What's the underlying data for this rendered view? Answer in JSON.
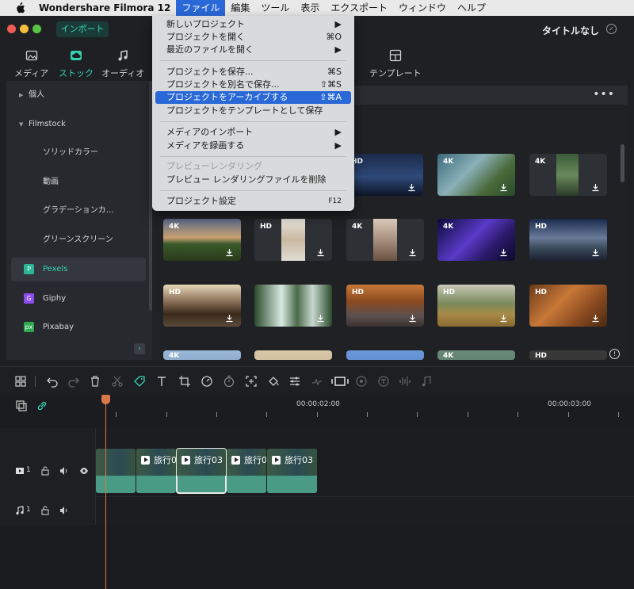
{
  "menubar": {
    "app_name": "Wondershare Filmora 12",
    "items": [
      "ファイル",
      "編集",
      "ツール",
      "表示",
      "エクスポート",
      "ウィンドウ",
      "ヘルプ"
    ]
  },
  "titlebar": {
    "import_label": "インポート",
    "title": "タイトルなし"
  },
  "tabs": [
    {
      "label": "メディア",
      "icon": "image-icon"
    },
    {
      "label": "ストック",
      "icon": "cloud-icon"
    },
    {
      "label": "オーディオ",
      "icon": "music-note-icon"
    },
    {
      "label": "テンプレート",
      "icon": "template-icon"
    }
  ],
  "sidebar": {
    "personal": "個人",
    "filmstock": "Filmstock",
    "filmstock_items": [
      "ソリッドカラー",
      "動画",
      "グラデーションカ…",
      "グリーンスクリーン"
    ],
    "providers": [
      {
        "label": "Pexels",
        "badge": "P",
        "color": "#2bb596"
      },
      {
        "label": "Giphy",
        "badge": "G",
        "color": "#8c4cf0"
      },
      {
        "label": "Pixabay",
        "badge": "px",
        "color": "#2ea84f"
      }
    ]
  },
  "thumbnails": [
    {
      "label": "HD"
    },
    {
      "label": "4K"
    },
    {
      "label": "4K"
    },
    {
      "label": "4K"
    },
    {
      "label": "HD"
    },
    {
      "label": "4K"
    },
    {
      "label": "4K"
    },
    {
      "label": "HD"
    },
    {
      "label": "HD"
    },
    {
      "label": ""
    },
    {
      "label": "HD"
    },
    {
      "label": "HD"
    },
    {
      "label": "HD"
    },
    {
      "label": "4K"
    },
    {
      "label": ""
    },
    {
      "label": ""
    },
    {
      "label": "4K"
    },
    {
      "label": "HD"
    }
  ],
  "file_menu": {
    "items": [
      {
        "label": "新しいプロジェクト",
        "shortcut": "▶"
      },
      {
        "label": "プロジェクトを開く",
        "shortcut": "⌘O"
      },
      {
        "label": "最近のファイルを開く",
        "shortcut": "▶"
      },
      {
        "label": "プロジェクトを保存...",
        "shortcut": "⌘S"
      },
      {
        "label": "プロジェクトを別名で保存...",
        "shortcut": "⇧⌘S"
      },
      {
        "label": "プロジェクトをアーカイブする",
        "shortcut": "⇧⌘A"
      },
      {
        "label": "プロジェクトをテンプレートとして保存",
        "shortcut": ""
      },
      {
        "label": "メディアのインポート",
        "shortcut": "▶"
      },
      {
        "label": "メディアを録画する",
        "shortcut": "▶"
      },
      {
        "label": "プレビューレンダリング",
        "shortcut": ""
      },
      {
        "label": "プレビュー レンダリングファイルを削除",
        "shortcut": ""
      },
      {
        "label": "プロジェクト設定",
        "shortcut": "F12"
      }
    ]
  },
  "timeline": {
    "timecodes": [
      "00:00:02:00",
      "00:00:03:00"
    ],
    "video_track": "1",
    "audio_track": "1",
    "clips": [
      "",
      "旅行0",
      "旅行03",
      "旅行0",
      "旅行03"
    ]
  },
  "colors": {
    "accent": "#32d3b3",
    "highlight": "#2a68d8",
    "playhead": "#d9784a",
    "clip": "#4a9b86"
  }
}
